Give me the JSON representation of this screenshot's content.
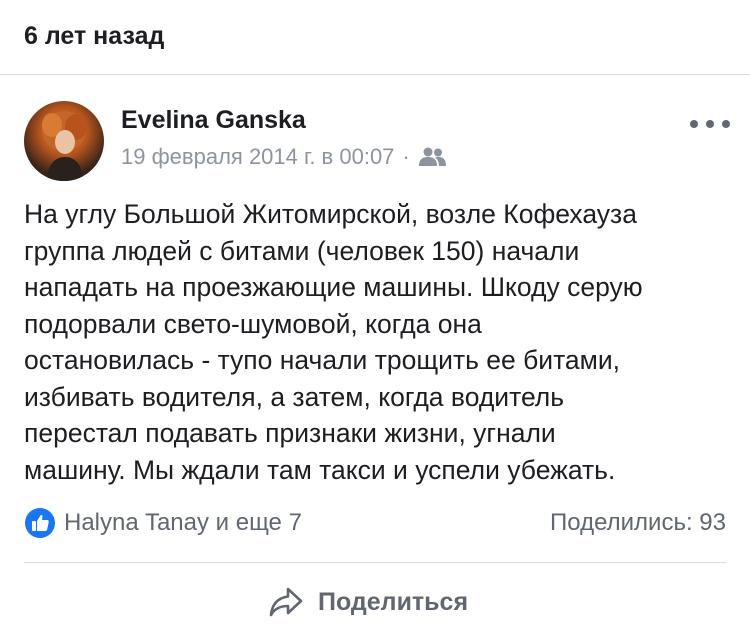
{
  "memory": {
    "header": "6 лет назад"
  },
  "post": {
    "author": "Evelina Ganska",
    "timestamp": "19 февраля 2014 г. в 00:07",
    "separator": "·",
    "audience_icon": "friends-icon",
    "more_icon": "more-options-icon",
    "text": "На углу Большой Житомирской, возле Кофехауза\nгруппа людей с битами (человек 150)  начали\nнападать на проезжающие машины. Шкоду серую\nподорвали свето-шумовой, когда она\nостановилась - тупо начали трощить ее битами,\nизбивать водителя, а затем, когда водитель\nперестал подавать признаки жизни, угнали\nмашину. Мы ждали там такси и успели убежать."
  },
  "engagement": {
    "reaction_icon": "like-icon",
    "reactions_text": "Halyna Tanay и еще 7",
    "shares_text": "Поделились: 93"
  },
  "actions": {
    "share_icon": "share-arrow-icon",
    "share_label": "Поделиться"
  },
  "colors": {
    "text_primary": "#1c1e21",
    "text_secondary": "#606770",
    "text_meta": "#8d949e",
    "like_blue": "#1877f2",
    "divider": "#dadde1"
  }
}
